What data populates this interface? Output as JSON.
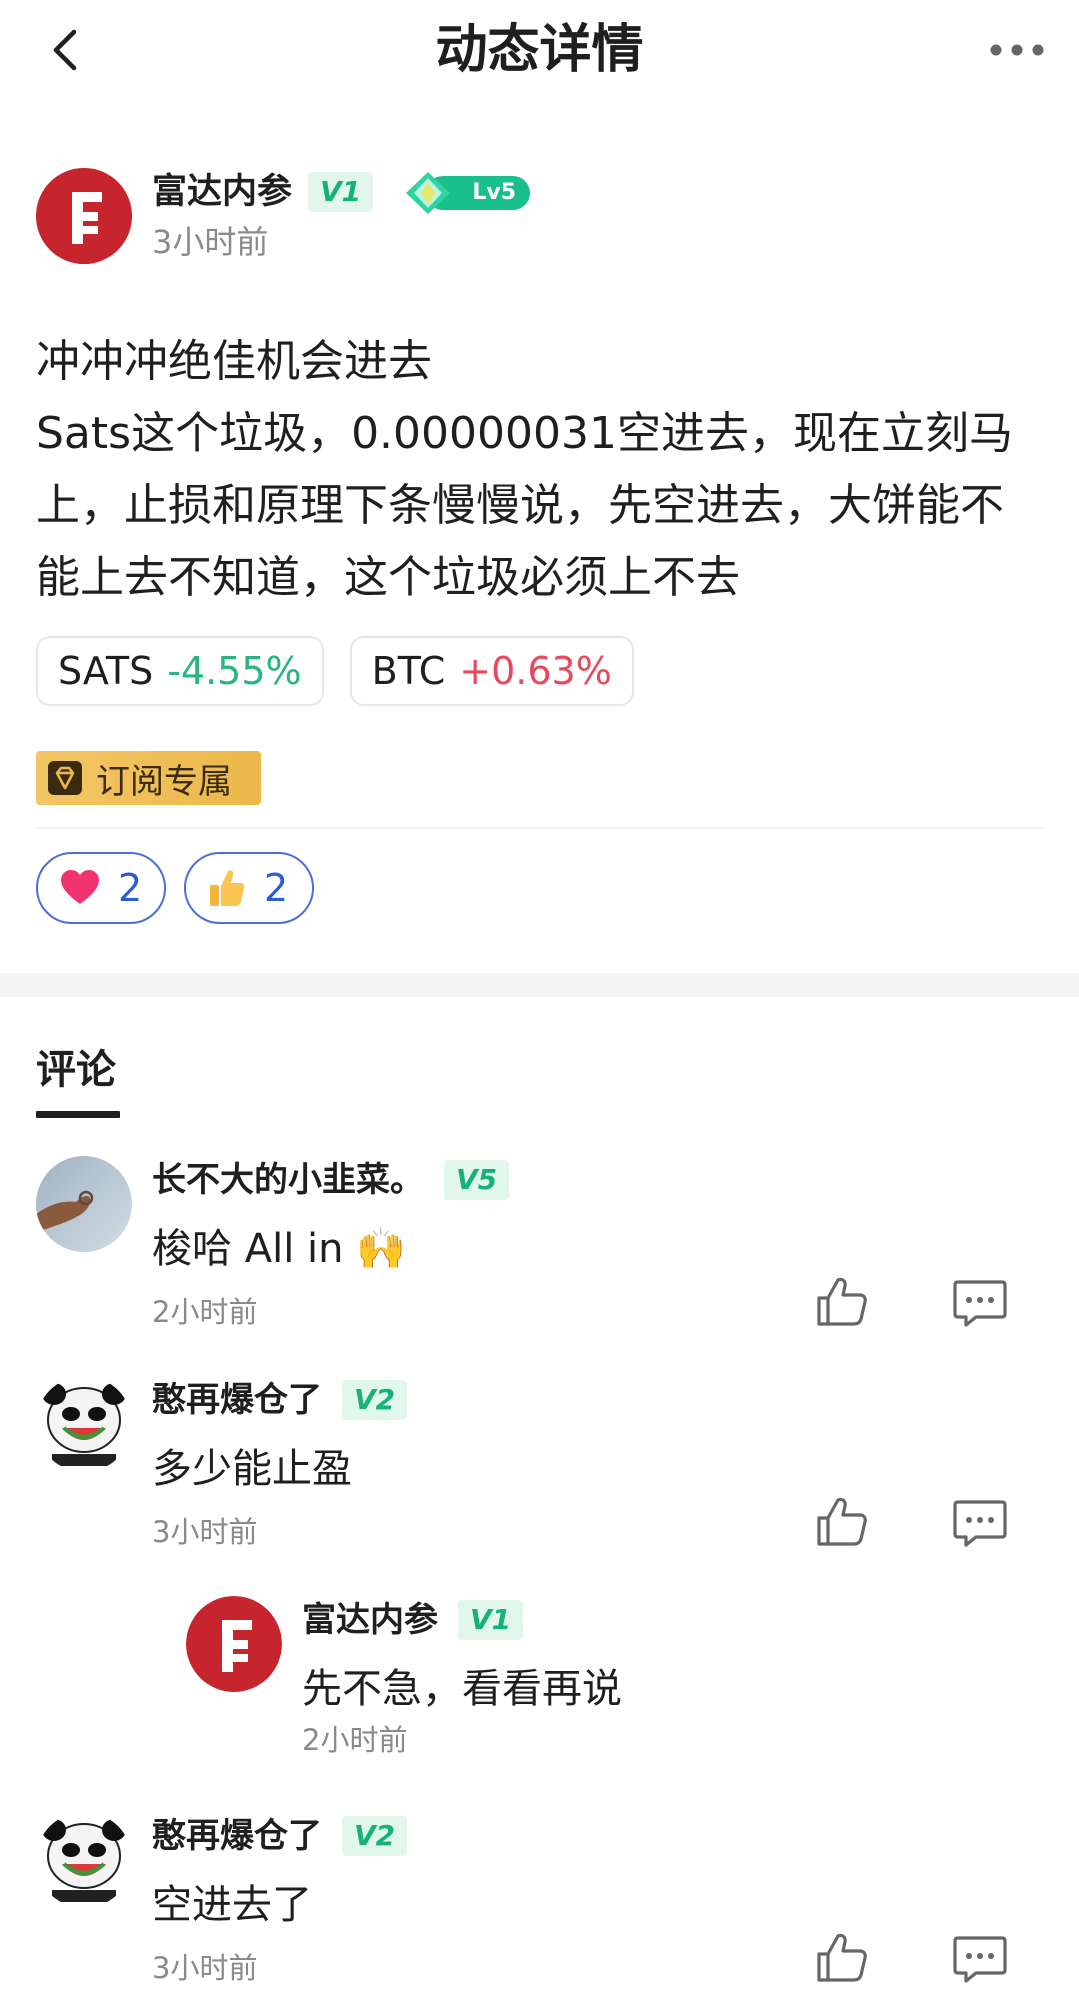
{
  "header": {
    "title": "动态详情"
  },
  "post": {
    "author": "富达内参",
    "vip": "V1",
    "level": "Lv5",
    "time": "3小时前",
    "content": "冲冲冲绝佳机会进去\nSats这个垃圾，0.00000031空进去，现在立刻马上，止损和原理下条慢慢说，先空进去，大饼能不能上去不知道，这个垃圾必须上不去",
    "tickers": [
      {
        "symbol": "SATS",
        "change": "-4.55%"
      },
      {
        "symbol": "BTC",
        "change": "+0.63%"
      }
    ],
    "subscribe_tag": "订阅专属",
    "reactions": [
      {
        "icon": "heart-icon",
        "count": "2"
      },
      {
        "icon": "thumbs-up-icon",
        "count": "2"
      }
    ]
  },
  "comments_section": {
    "title": "评论",
    "comments": [
      {
        "author": "长不大的小韭菜。",
        "vip": "V5",
        "text": "梭哈 All in 🙌",
        "time": "2小时前"
      },
      {
        "author": "憨再爆仓了",
        "vip": "V2",
        "text": "多少能止盈",
        "time": "3小时前",
        "reply": {
          "author": "富达内参",
          "vip": "V1",
          "text": "先不急，看看再说",
          "time": "2小时前"
        }
      },
      {
        "author": "憨再爆仓了",
        "vip": "V2",
        "text": "空进去了",
        "time": "3小时前"
      }
    ]
  },
  "colors": {
    "accent_green": "#16b27a",
    "down": "#29b67e",
    "up": "#e8495c",
    "reaction_blue": "#2f5ad6",
    "brand_red": "#c6252d",
    "gold": "#ecb84b"
  }
}
